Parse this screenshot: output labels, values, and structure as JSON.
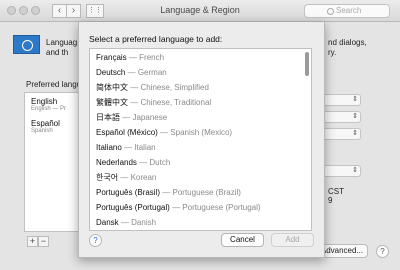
{
  "window": {
    "title": "Language & Region",
    "back_glyph": "‹",
    "forward_glyph": "›",
    "grid_glyph": "⋮⋮",
    "search_placeholder": "Search"
  },
  "background": {
    "desc_line1_left": "Languag",
    "desc_line2_left": "and th",
    "desc_line1_right": "nd dialogs,",
    "desc_line2_right": "ry.",
    "preferred_label": "Preferred langu",
    "preferred": [
      {
        "name": "English",
        "sub": "English — Pr"
      },
      {
        "name": "Español",
        "sub": "Spanish"
      }
    ],
    "add_glyph": "+",
    "remove_glyph": "−",
    "time_text": "CST",
    "sample_text": "9",
    "advanced_label": "Advanced...",
    "help_glyph": "?"
  },
  "sheet": {
    "title": "Select a preferred language to add:",
    "languages": [
      {
        "native": "Français",
        "english": "French"
      },
      {
        "native": "Deutsch",
        "english": "German"
      },
      {
        "native": "简体中文",
        "english": "Chinese, Simplified"
      },
      {
        "native": "繁體中文",
        "english": "Chinese, Traditional"
      },
      {
        "native": "日本語",
        "english": "Japanese"
      },
      {
        "native": "Español (México)",
        "english": "Spanish (Mexico)"
      },
      {
        "native": "Italiano",
        "english": "Italian"
      },
      {
        "native": "Nederlands",
        "english": "Dutch"
      },
      {
        "native": "한국어",
        "english": "Korean"
      },
      {
        "native": "Português (Brasil)",
        "english": "Portuguese (Brazil)"
      },
      {
        "native": "Português (Portugal)",
        "english": "Portuguese (Portugal)"
      },
      {
        "native": "Dansk",
        "english": "Danish"
      }
    ],
    "separator": "—",
    "help_glyph": "?",
    "cancel_label": "Cancel",
    "add_label": "Add"
  }
}
